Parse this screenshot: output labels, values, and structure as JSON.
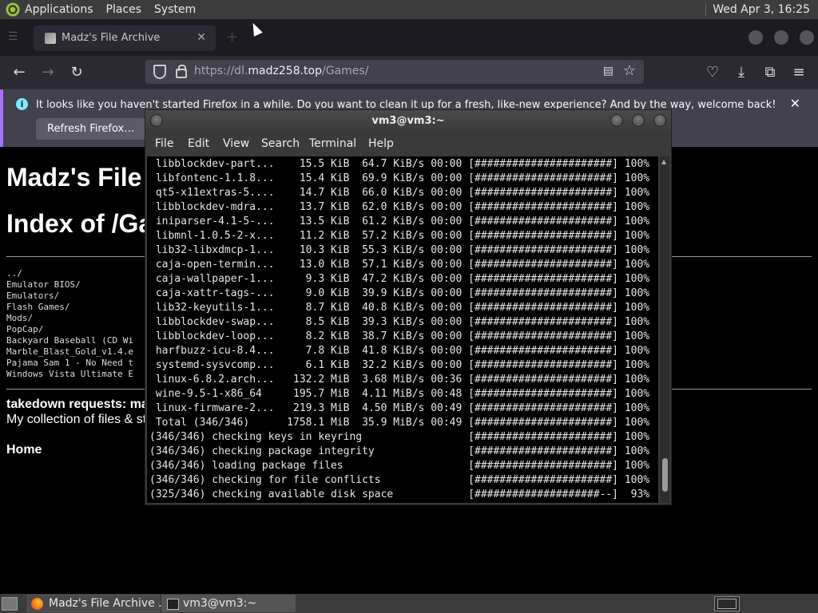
{
  "top_panel": {
    "menus": [
      "Applications",
      "Places",
      "System"
    ],
    "clock": "Wed Apr  3, 16:25"
  },
  "firefox": {
    "tab_title": "Madz's File Archive",
    "url_prefix": "https://dl.",
    "url_domain": "madz258.top",
    "url_path": "/Games/",
    "notification": {
      "message": "It looks like you haven't started Firefox in a while. Do you want to clean it up for a fresh, like-new experience? And by the way, welcome back!",
      "button": "Refresh Firefox…"
    }
  },
  "page": {
    "heading1": "Madz's File",
    "heading2": "Index of /Ga",
    "listing": [
      "../",
      "Emulator BIOS/",
      "Emulators/",
      "Flash Games/",
      "Mods/",
      "PopCap/",
      "Backyard Baseball (CD Wi",
      "Marble_Blast_Gold_v1.4.e",
      "Pajama Sam 1 - No Need t",
      "Windows Vista Ultimate E"
    ],
    "takedown": "takedown requests: ma",
    "collection": "My collection of files & st",
    "home": "Home"
  },
  "terminal": {
    "title": "vm3@vm3:~",
    "menus": [
      "File",
      "Edit",
      "View",
      "Search",
      "Terminal",
      "Help"
    ],
    "lines": [
      " libblockdev-part...    15.5 KiB  64.7 KiB/s 00:00 [######################] 100%",
      " libfontenc-1.1.8...    15.4 KiB  69.9 KiB/s 00:00 [######################] 100%",
      " qt5-x11extras-5....    14.7 KiB  66.0 KiB/s 00:00 [######################] 100%",
      " libblockdev-mdra...    13.7 KiB  62.0 KiB/s 00:00 [######################] 100%",
      " iniparser-4.1-5-...    13.5 KiB  61.2 KiB/s 00:00 [######################] 100%",
      " libmnl-1.0.5-2-x...    11.2 KiB  57.2 KiB/s 00:00 [######################] 100%",
      " lib32-libxdmcp-1...    10.3 KiB  55.3 KiB/s 00:00 [######################] 100%",
      " caja-open-termin...    13.0 KiB  57.1 KiB/s 00:00 [######################] 100%",
      " caja-wallpaper-1...     9.3 KiB  47.2 KiB/s 00:00 [######################] 100%",
      " caja-xattr-tags-...     9.0 KiB  39.9 KiB/s 00:00 [######################] 100%",
      " lib32-keyutils-1...     8.7 KiB  40.8 KiB/s 00:00 [######################] 100%",
      " libblockdev-swap...     8.5 KiB  39.3 KiB/s 00:00 [######################] 100%",
      " libblockdev-loop...     8.2 KiB  38.7 KiB/s 00:00 [######################] 100%",
      " harfbuzz-icu-8.4...     7.8 KiB  41.8 KiB/s 00:00 [######################] 100%",
      " systemd-sysvcomp...     6.1 KiB  32.2 KiB/s 00:00 [######################] 100%",
      " linux-6.8.2.arch...   132.2 MiB  3.68 MiB/s 00:36 [######################] 100%",
      " wine-9.5-1-x86_64     195.7 MiB  4.11 MiB/s 00:48 [######################] 100%",
      " linux-firmware-2...   219.3 MiB  4.50 MiB/s 00:49 [######################] 100%",
      " Total (346/346)      1758.1 MiB  35.9 MiB/s 00:49 [######################] 100%",
      "(346/346) checking keys in keyring                 [######################] 100%",
      "(346/346) checking package integrity               [######################] 100%",
      "(346/346) loading package files                    [######################] 100%",
      "(346/346) checking for file conflicts              [######################] 100%",
      "(325/346) checking available disk space            [####################--]  93%"
    ]
  },
  "taskbar": {
    "items": [
      "Madz's File Archive ...",
      "vm3@vm3:~"
    ]
  }
}
